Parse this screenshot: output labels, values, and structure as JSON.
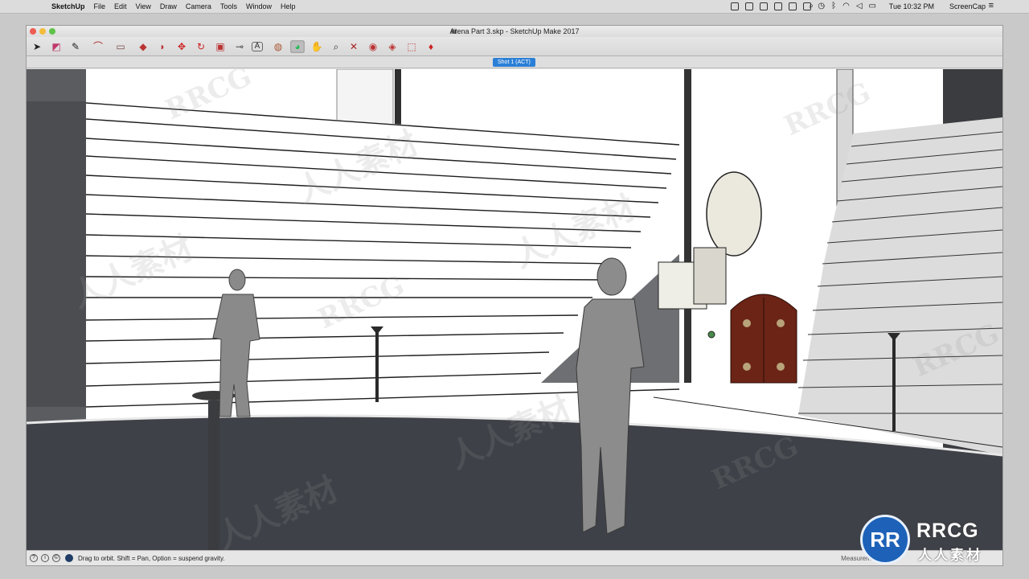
{
  "menubar": {
    "apple": "",
    "items": [
      "SketchUp",
      "File",
      "Edit",
      "View",
      "Draw",
      "Camera",
      "Tools",
      "Window",
      "Help"
    ],
    "clock": "Tue 10:32 PM",
    "user": "ScreenCap"
  },
  "window": {
    "title": "Arena Part 3.skp - SketchUp Make 2017"
  },
  "toolbar": {
    "tools": [
      {
        "name": "select-tool",
        "glyph": "➤"
      },
      {
        "name": "eraser-tool",
        "glyph": "◩"
      },
      {
        "name": "line-tool",
        "glyph": "✎"
      },
      {
        "name": "arc-tool",
        "glyph": "⌒"
      },
      {
        "name": "shape-tool",
        "glyph": "▭"
      },
      {
        "name": "push-pull-tool",
        "glyph": "◆"
      },
      {
        "name": "follow-me-tool",
        "glyph": "◗"
      },
      {
        "name": "move-tool",
        "glyph": "✥"
      },
      {
        "name": "rotate-tool",
        "glyph": "↻"
      },
      {
        "name": "scale-tool",
        "glyph": "▣"
      },
      {
        "name": "tape-measure-tool",
        "glyph": "⊸"
      },
      {
        "name": "text-tool",
        "glyph": "A"
      },
      {
        "name": "paint-bucket-tool",
        "glyph": "◍"
      },
      {
        "name": "orbit-tool",
        "glyph": "◕"
      },
      {
        "name": "pan-tool",
        "glyph": "✋"
      },
      {
        "name": "zoom-tool",
        "glyph": "⌕"
      },
      {
        "name": "zoom-extents-tool",
        "glyph": "✕"
      },
      {
        "name": "3d-warehouse-tool",
        "glyph": "◉"
      },
      {
        "name": "extension-warehouse-tool",
        "glyph": "◈"
      },
      {
        "name": "layout-tool",
        "glyph": "⬚"
      },
      {
        "name": "ruby-tool",
        "glyph": "♦"
      }
    ]
  },
  "scenes": {
    "active_tab": "Shot 1 (ACT)"
  },
  "statusbar": {
    "hint": "Drag to orbit. Shift = Pan, Option = suspend gravity.",
    "measurements_label": "Measurements"
  },
  "watermarks": {
    "latin": "RRCG",
    "cjk": "人人素材"
  },
  "logo": {
    "mark": "RR",
    "brand": "RRCG",
    "subtitle": "人人素材"
  },
  "colors": {
    "scene_tab": "#2b7fd6",
    "logo_blue": "#1d62b8",
    "door": "#6b2416",
    "floor": "#3e4147",
    "figures": "#8a8a8a"
  }
}
